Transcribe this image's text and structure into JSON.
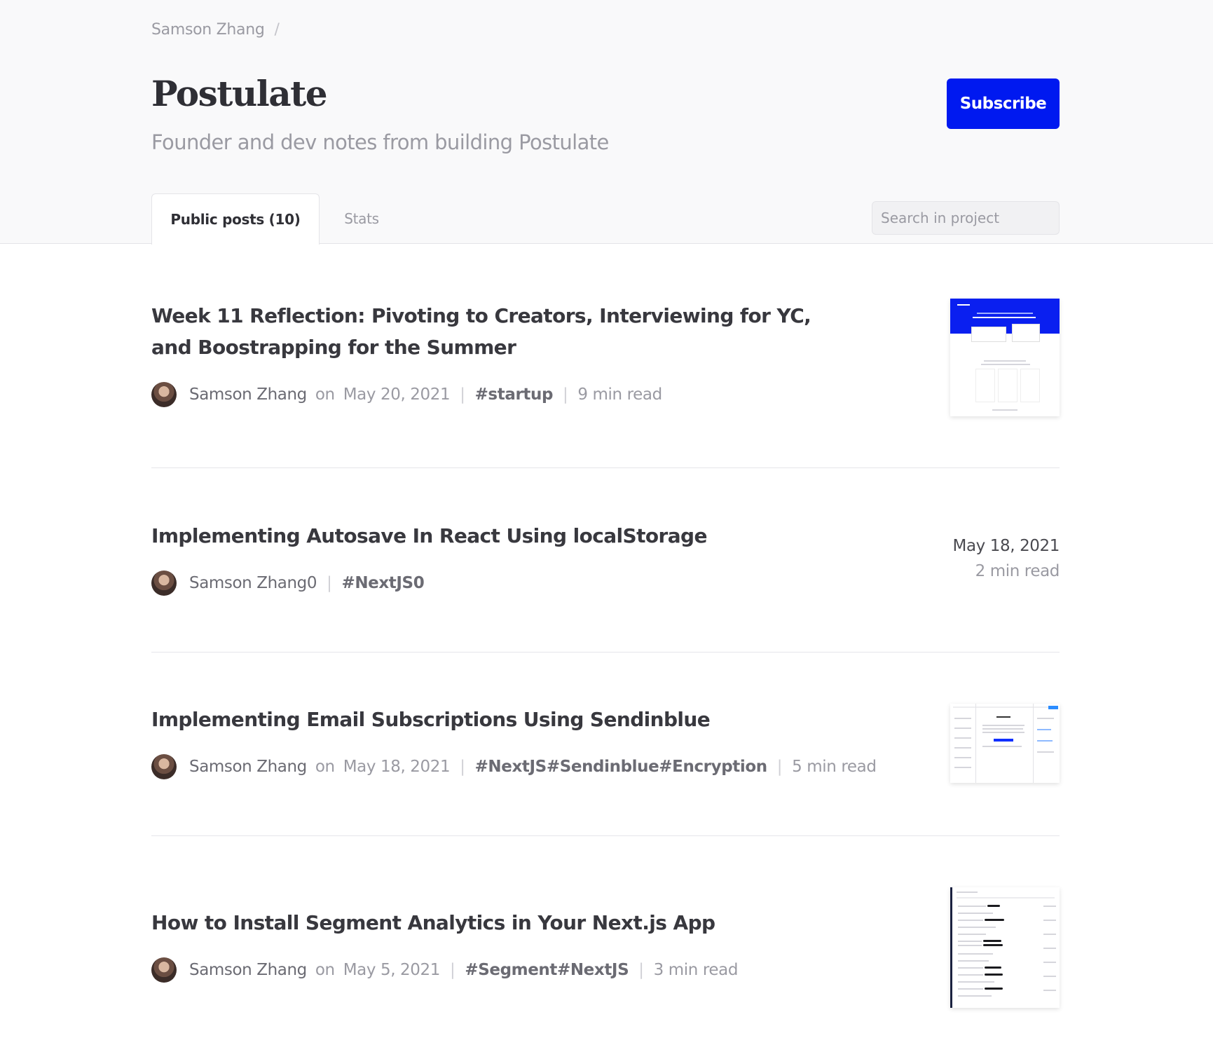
{
  "breadcrumb": {
    "user": "Samson Zhang",
    "separator": "/"
  },
  "project": {
    "title": "Postulate",
    "subtitle": "Founder and dev notes from building Postulate",
    "subscribe_label": "Subscribe"
  },
  "tabs": [
    {
      "label": "Public posts (10)",
      "active": true
    },
    {
      "label": "Stats",
      "active": false
    }
  ],
  "search": {
    "placeholder": "Search in project",
    "value": ""
  },
  "posts": [
    {
      "title": "Week 11 Reflection: Pivoting to Creators, Interviewing for YC, and Boostrapping for the Summer",
      "author": "Samson Zhang",
      "on": "on",
      "date": "May 20, 2021",
      "tags": "#startup",
      "read_time": "9 min read",
      "thumbnail": "landing-page-screenshot"
    },
    {
      "title": "Implementing Autosave In React Using localStorage",
      "author": "Samson Zhang0",
      "tags": "#NextJS0",
      "date": "May 18, 2021",
      "read_time": "2 min read"
    },
    {
      "title": "Implementing Email Subscriptions Using Sendinblue",
      "author": "Samson Zhang",
      "on": "on",
      "date": "May 18, 2021",
      "tags": "#NextJS#Sendinblue#Encryption",
      "read_time": "5 min read",
      "thumbnail": "editor-screenshot"
    },
    {
      "title": "How to Install Segment Analytics in Your Next.js App",
      "author": "Samson Zhang",
      "on": "on",
      "date": "May 5, 2021",
      "tags": "#Segment#NextJS",
      "read_time": "3 min read",
      "thumbnail": "table-screenshot"
    }
  ],
  "colors": {
    "accent": "#0019f0",
    "header_bg": "#f9f9fa",
    "muted": "#9a9aa2"
  }
}
